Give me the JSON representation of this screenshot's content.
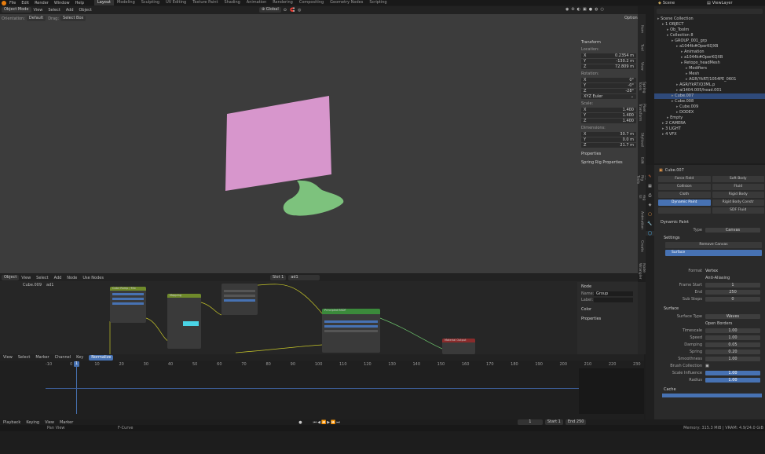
{
  "menu": {
    "items": [
      "File",
      "Edit",
      "Render",
      "Window",
      "Help"
    ],
    "workspaces": [
      "Layout",
      "Modeling",
      "Sculpting",
      "UV Editing",
      "Texture Paint",
      "Shading",
      "Animation",
      "Rendering",
      "Compositing",
      "Geometry Nodes",
      "Scripting"
    ],
    "active_workspace": "Layout",
    "scene": "Scene",
    "view_layer": "ViewLayer"
  },
  "viewport_header": {
    "mode": "Object Mode",
    "view": "View",
    "select": "Select",
    "add": "Add",
    "object": "Object",
    "orientation_label": "Orientation:",
    "orientation_value": "Default",
    "drag_label": "Drag:",
    "drag_value": "Select Box",
    "transform_space": "Global",
    "options": "Options"
  },
  "n_panel": {
    "title": "Transform",
    "location_label": "Location:",
    "location": [
      {
        "axis": "X",
        "value": "0.2354 m"
      },
      {
        "axis": "Y",
        "value": "-130.2 m"
      },
      {
        "axis": "Z",
        "value": "72.809 m"
      }
    ],
    "rotation_label": "Rotation:",
    "rotation": [
      {
        "axis": "X",
        "value": "0°"
      },
      {
        "axis": "Y",
        "value": "-0°"
      },
      {
        "axis": "Z",
        "value": "-28°"
      }
    ],
    "rotation_mode": "XYZ Euler",
    "scale_label": "Scale:",
    "scale": [
      {
        "axis": "X",
        "value": "1.400"
      },
      {
        "axis": "Y",
        "value": "1.400"
      },
      {
        "axis": "Z",
        "value": "1.400"
      }
    ],
    "dimensions_label": "Dimensions:",
    "dimensions": [
      {
        "axis": "X",
        "value": "30.7 m"
      },
      {
        "axis": "Y",
        "value": "0.0 m"
      },
      {
        "axis": "Z",
        "value": "21.7 m"
      }
    ],
    "properties": "Properties",
    "spring_rig": "Spring Rig Properties"
  },
  "viewport_tabs": [
    "Item",
    "Tool",
    "View",
    "Spring Tools",
    "Pixel Transform",
    "Stylized",
    "Edit",
    "BB Rig Tools",
    "Rig UI",
    "Animation",
    "Create",
    "Node Wrangler"
  ],
  "outliner": {
    "search_placeholder": "",
    "rows": [
      {
        "indent": 0,
        "text": "Scene Collection",
        "selected": false
      },
      {
        "indent": 1,
        "text": "1 OBJECT",
        "selected": false
      },
      {
        "indent": 2,
        "text": "Ob_Toolm",
        "selected": false
      },
      {
        "indent": 2,
        "text": "Collection 8",
        "selected": false
      },
      {
        "indent": 3,
        "text": "GROUP_001_grp",
        "selected": false
      },
      {
        "indent": 4,
        "text": "a1044k#OperKQXB",
        "selected": false
      },
      {
        "indent": 5,
        "text": "Animation",
        "selected": false
      },
      {
        "indent": 5,
        "text": "a1044k#OperKQXB",
        "selected": false
      },
      {
        "indent": 5,
        "text": "Retopo_headMesh",
        "selected": false
      },
      {
        "indent": 6,
        "text": "Modifiers",
        "selected": false
      },
      {
        "indent": 6,
        "text": "Mesh",
        "selected": false
      },
      {
        "indent": 6,
        "text": "AGR/YkRT/1054PE_0601",
        "selected": false
      },
      {
        "indent": 4,
        "text": "AGR/YkRT/Q3ML.p",
        "selected": false
      },
      {
        "indent": 4,
        "text": "ai1404.005/head.001",
        "selected": false
      },
      {
        "indent": 3,
        "text": "Cube.007",
        "selected": true
      },
      {
        "indent": 3,
        "text": "Cube.008",
        "selected": false
      },
      {
        "indent": 4,
        "text": "Cube.009",
        "selected": false
      },
      {
        "indent": 4,
        "text": "DODEX",
        "selected": false
      },
      {
        "indent": 2,
        "text": "Empty",
        "selected": false
      },
      {
        "indent": 1,
        "text": "2 CAMERA",
        "selected": false
      },
      {
        "indent": 1,
        "text": "3 LIGHT",
        "selected": false
      },
      {
        "indent": 1,
        "text": "4 VFX",
        "selected": false
      }
    ]
  },
  "properties": {
    "object_name": "Cube.007",
    "physics_buttons": [
      {
        "label": "Force Field",
        "active": false
      },
      {
        "label": "Soft Body",
        "active": false
      },
      {
        "label": "Collision",
        "active": false
      },
      {
        "label": "Fluid",
        "active": false
      },
      {
        "label": "Cloth",
        "active": false
      },
      {
        "label": "Rigid Body",
        "active": false
      },
      {
        "label": "Dynamic Paint",
        "active": true
      },
      {
        "label": "Rigid Body Constr",
        "active": false
      },
      {
        "label": "",
        "active": false
      },
      {
        "label": "SDF Fluid",
        "active": false
      }
    ],
    "dynamic_paint_title": "Dynamic Paint",
    "type_label": "Type",
    "type_value": "Canvas",
    "settings_title": "Settings",
    "remove_canvas": "Remove Canvas",
    "surface_item": "Surface",
    "format_label": "Format",
    "format_value": "Vertex",
    "anti_aliasing": "Anti-Aliasing",
    "frame_start_label": "Frame Start",
    "frame_start": "1",
    "end_label": "End",
    "end": "250",
    "substeps_label": "Sub Steps",
    "substeps": "0",
    "surface_title": "Surface",
    "surface_type_label": "Surface Type",
    "surface_type": "Waves",
    "open_borders": "Open Borders",
    "timescale_label": "Timescale",
    "timescale": "1.00",
    "speed_label": "Speed",
    "speed": "1.00",
    "damping_label": "Damping",
    "damping": "0.05",
    "spring_label": "Spring",
    "spring": "0.20",
    "smoothness_label": "Smoothness",
    "smoothness": "1.00",
    "brush_collection_label": "Brush Collection",
    "scale_influence_label": "Scale Influence",
    "scale_influence": "1.00",
    "radius_label": "Radius",
    "radius": "1.00",
    "cache_title": "Cache"
  },
  "node_editor": {
    "editor_type": "Object",
    "view": "View",
    "select": "Select",
    "add": "Add",
    "node": "Node",
    "use_nodes": "Use Nodes",
    "slot": "Slot 1",
    "material": "ad1",
    "breadcrumb_obj": "Cube.009",
    "breadcrumb_mat": "ad1",
    "sidebar_node_title": "Node",
    "sidebar_name_label": "Name:",
    "sidebar_name": "Group",
    "sidebar_label_label": "Label:",
    "sidebar_color": "Color",
    "sidebar_properties": "Properties",
    "nodes": [
      {
        "title": "Color Ramp / Mix",
        "color": "#6f8a2b"
      },
      {
        "title": "Mapping",
        "color": "#6f8a2b"
      },
      {
        "title": "",
        "color": "#3a3a3a"
      },
      {
        "title": "Principled BSDF",
        "color": "#3b8a3b"
      },
      {
        "title": "Material Output",
        "color": "#8a2b2b"
      }
    ]
  },
  "timeline": {
    "view": "View",
    "select": "Select",
    "marker": "Marker",
    "channel": "Channel",
    "key": "Key",
    "normalize": "Normalize",
    "ticks": [
      "-10",
      "0",
      "10",
      "20",
      "30",
      "40",
      "50",
      "60",
      "70",
      "80",
      "90",
      "100",
      "110",
      "120",
      "130",
      "140",
      "150",
      "160",
      "170",
      "180",
      "190",
      "200",
      "210",
      "220",
      "230"
    ],
    "current_frame": "1"
  },
  "footer": {
    "playback": "Playback",
    "keying": "Keying",
    "view": "View",
    "marker": "Marker",
    "current_frame": "1",
    "start_label": "Start",
    "start": "1",
    "end_label": "End",
    "end": "250",
    "pan_view": "Pan View",
    "fcurve": "F-Curve",
    "memory": "Memory: 315.3 MiB | VRAM: 4.9/24.0 GiB"
  },
  "colors": {
    "accent": "#4772b3",
    "plane": "#d796cc",
    "blob": "#7dc27d"
  }
}
